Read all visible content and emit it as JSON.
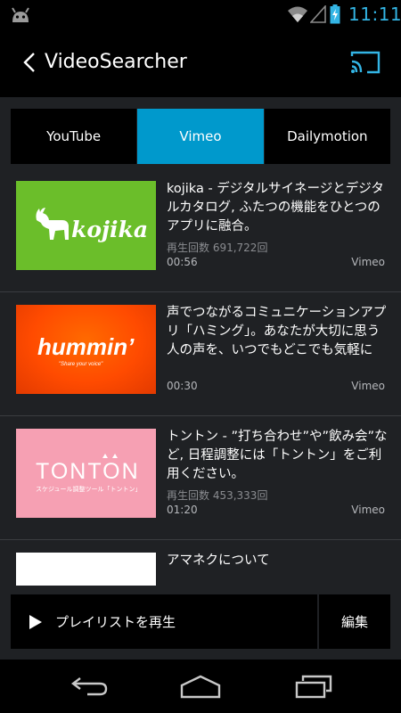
{
  "status": {
    "time": "11:11"
  },
  "app": {
    "title": "VideoSearcher"
  },
  "tabs": [
    {
      "label": "YouTube",
      "active": false
    },
    {
      "label": "Vimeo",
      "active": true
    },
    {
      "label": "Dailymotion",
      "active": false
    }
  ],
  "videos": [
    {
      "desc": "kojika - デジタルサイネージとデジタルカタログ, ふたつの機能をひとつのアプリに融合。",
      "views": "再生回数 691,722回",
      "duration": "00:56",
      "source": "Vimeo",
      "thumb": {
        "brand": "kojika",
        "bg": "#6bbe2a"
      }
    },
    {
      "desc": "声でつながるコミュニケーションアプリ「ハミング」。あなたが大切に思う人の声を、いつでもどこでも気軽に聴...",
      "views": "",
      "duration": "00:30",
      "source": "Vimeo",
      "thumb": {
        "brand": "hummin’",
        "tagline": "\"Share your voice\"",
        "bg": "#ff4b00"
      }
    },
    {
      "desc": "トントン - ”打ち合わせ”や”飲み会”など, 日程調整には「トントン」をご利用ください。",
      "views": "再生回数 453,333回",
      "duration": "01:20",
      "source": "Vimeo",
      "thumb": {
        "brand": "TONTON",
        "tagline": "スケジュール調整ツール「トントン」",
        "bg": "#f6a0b3"
      }
    },
    {
      "desc": "アマネクについて",
      "views": "",
      "duration": "",
      "source": "",
      "thumb": {
        "bg": "#ffffff"
      }
    }
  ],
  "playlist": {
    "play_label": "プレイリストを再生",
    "edit_label": "編集"
  },
  "colors": {
    "accent": "#0099cc",
    "clock": "#33b5e5",
    "cast": "#33b5e5"
  }
}
